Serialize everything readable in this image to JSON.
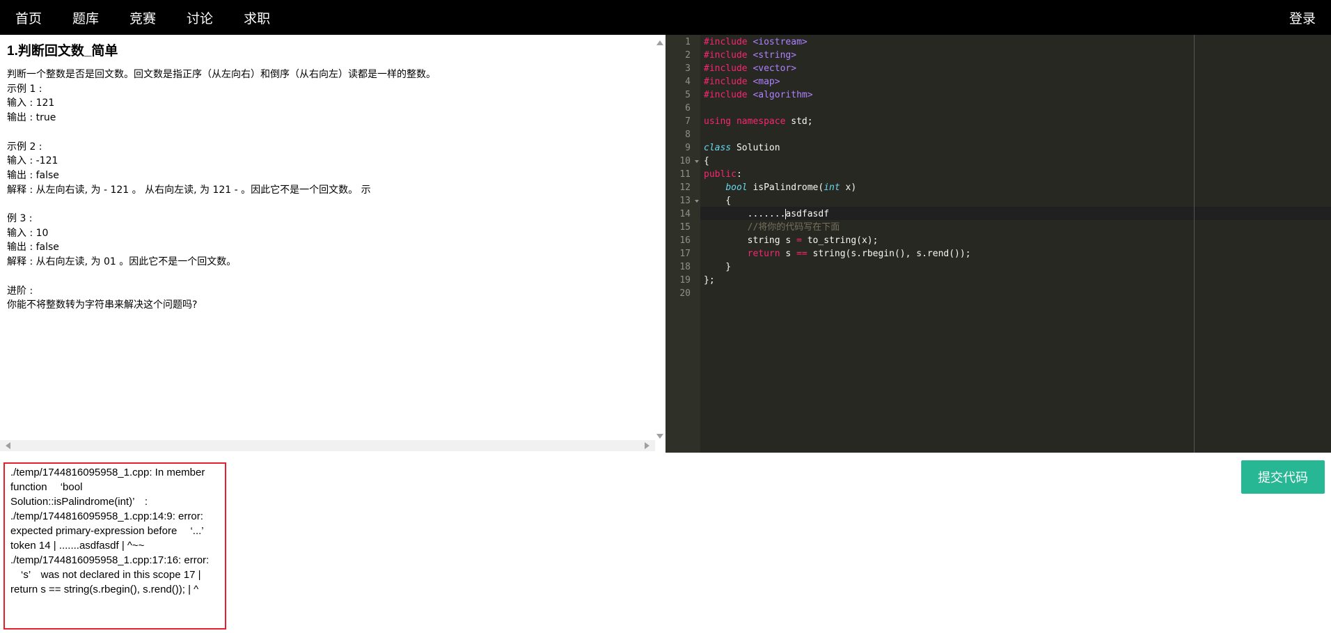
{
  "nav": {
    "items": [
      "首页",
      "题库",
      "竞赛",
      "讨论",
      "求职"
    ],
    "login": "登录"
  },
  "problem": {
    "title": "1.判断回文数_简单",
    "text": "判断一个整数是否是回文数。回文数是指正序（从左向右）和倒序（从右向左）读都是一样的整数。\n示例 1 :\n输入 : 121\n输出 : true\n\n示例 2 :\n输入 : -121\n输出 : false\n解释 : 从左向右读, 为 - 121 。 从右向左读, 为 121 - 。因此它不是一个回文数。 示\n\n例 3 :\n输入 : 10\n输出 : false\n解释 : 从右向左读, 为 01 。因此它不是一个回文数。\n\n进阶 :\n你能不将整数转为字符串来解决这个问题吗?"
  },
  "editor": {
    "line_numbers": [
      "1",
      "2",
      "3",
      "4",
      "5",
      "6",
      "7",
      "8",
      "9",
      "10",
      "11",
      "12",
      "13",
      "14",
      "15",
      "16",
      "17",
      "18",
      "19",
      "20"
    ],
    "lines": {
      "l1_kw": "#include",
      "l1_inc": " <iostream>",
      "l2_kw": "#include",
      "l2_inc": " <string>",
      "l3_kw": "#include",
      "l3_inc": " <vector>",
      "l4_kw": "#include",
      "l4_inc": " <map>",
      "l5_kw": "#include",
      "l5_inc": " <algorithm>",
      "l7_kw1": "using",
      "l7_kw2": " namespace",
      "l7_rest": " std;",
      "l9_kw": "class",
      "l9_rest": " Solution",
      "l10": "{",
      "l11_kw": "public",
      "l11_rest": ":",
      "l12_indent": "    ",
      "l12_ty": "bool",
      "l12_fn": " isPalindrome(",
      "l12_ty2": "int",
      "l12_rest": " x)",
      "l13": "    {",
      "l14_a": "        .......",
      "l14_b": "asdfasdf",
      "l15_indent": "        ",
      "l15_cm": "//将你的代码写在下面",
      "l16_a": "        string s ",
      "l16_op": "=",
      "l16_b": " to_string(x);",
      "l17_indent": "        ",
      "l17_kw": "return",
      "l17_a": " s ",
      "l17_op": "==",
      "l17_b": " string(s.rbegin(), s.rend());",
      "l18": "    }",
      "l19": "};"
    }
  },
  "output": {
    "text": "./temp/1744816095958_1.cpp: In member function 　‘bool Solution::isPalindrome(int)’　: ./temp/1744816095958_1.cpp:14:9: error: expected primary-expression before 　‘...’　token 14 | .......asdfasdf | ^~~ ./temp/1744816095958_1.cpp:17:16: error: 　‘s’　was not declared in this scope 17 | return s == string(s.rbegin(), s.rend()); | ^"
  },
  "submit_label": "提交代码",
  "colors": {
    "navbar": "#000000",
    "editor_bg": "#272822",
    "submit": "#27b794",
    "error_border": "#e41e2a"
  }
}
